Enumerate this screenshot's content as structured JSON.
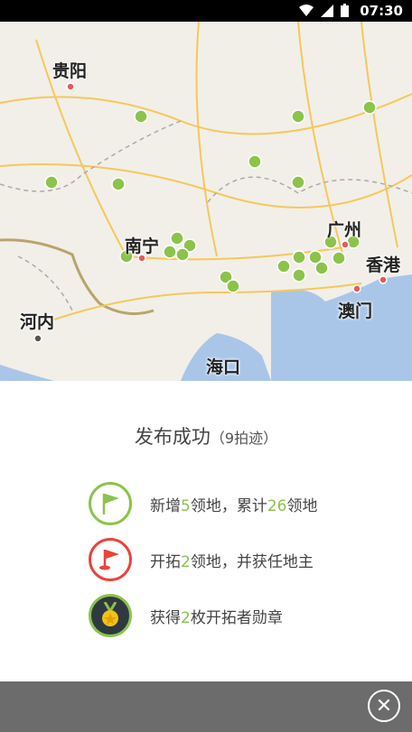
{
  "status_bar": {
    "time": "07:30"
  },
  "map": {
    "cities": [
      {
        "name": "贵阳"
      },
      {
        "name": "南宁"
      },
      {
        "name": "广州"
      },
      {
        "name": "香港"
      },
      {
        "name": "澳门"
      },
      {
        "name": "河内"
      },
      {
        "name": "海口"
      }
    ]
  },
  "result": {
    "title": "发布成功",
    "count_open": "（",
    "count_value": "9",
    "count_unit": "拍迹）",
    "items": [
      {
        "pre": "新增",
        "n1": "5",
        "mid": "领地，累计",
        "n2": "26",
        "post": "领地"
      },
      {
        "pre": "开拓",
        "n1": "2",
        "mid": "领地，并获任地主",
        "n2": "",
        "post": ""
      },
      {
        "pre": "获得",
        "n1": "2",
        "mid": "枚开拓者勋章",
        "n2": "",
        "post": ""
      }
    ]
  },
  "footer": {
    "close_label": "✕"
  },
  "colors": {
    "accent_green": "#8cc34b",
    "flag_red": "#e8443a",
    "medal_dark": "#2f3a40",
    "footer_gray": "#6c6c6c"
  }
}
